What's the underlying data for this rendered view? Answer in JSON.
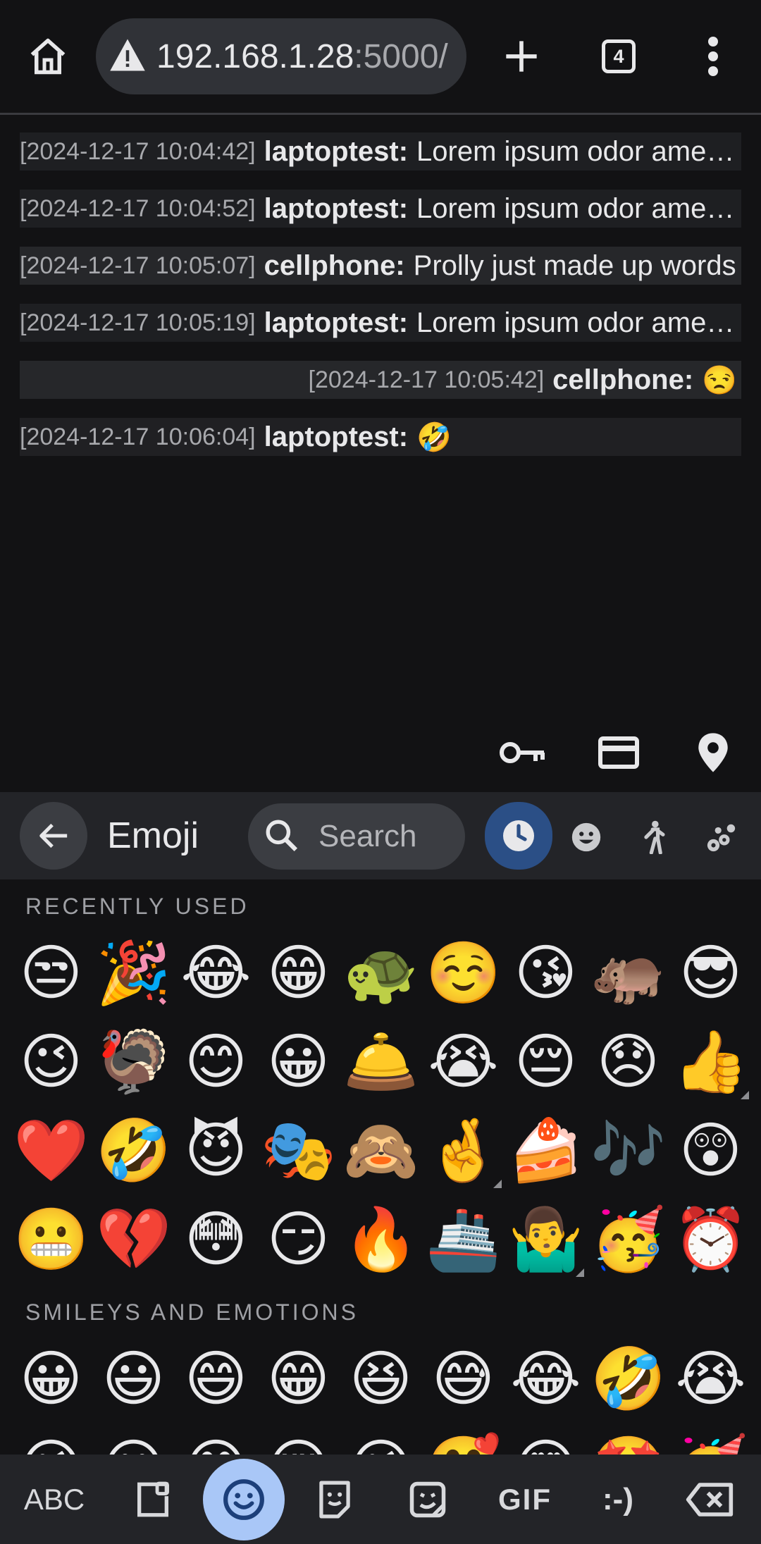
{
  "browser": {
    "url_host": "192.168.1.28",
    "url_port": ":5000/",
    "tab_count": "4"
  },
  "messages": [
    {
      "timestamp": "[2024-12-17 10:04:42]",
      "user": "laptoptest:",
      "text": "Lorem ipsum odor amet, consectetuer adipiscing elit."
    },
    {
      "timestamp": "[2024-12-17 10:04:52]",
      "user": "laptoptest:",
      "text": "Lorem ipsum odor amet, consectetuer adipiscing elit."
    },
    {
      "timestamp": "[2024-12-17 10:05:07]",
      "user": "cellphone:",
      "text": "Prolly just made up words"
    },
    {
      "timestamp": "[2024-12-17 10:05:19]",
      "user": "laptoptest:",
      "text": "Lorem ipsum odor amet, consectetuer adipiscing elit."
    },
    {
      "timestamp": "[2024-12-17 10:05:42]",
      "user": "cellphone:",
      "text": "😒"
    },
    {
      "timestamp": "[2024-12-17 10:06:04]",
      "user": "laptoptest:",
      "text": "🤣"
    }
  ],
  "autofill": {
    "icons": [
      "key-icon",
      "credit-card-icon",
      "location-pin-icon"
    ]
  },
  "keyboard": {
    "title": "Emoji",
    "search_placeholder": "Search",
    "categories": [
      "recent-clock-icon",
      "smiley-category-icon",
      "people-activity-icon",
      "animals-nature-icon"
    ],
    "active_category": "recent-clock-icon",
    "accent_color": "#2b4f86",
    "sections": {
      "recent_label": "RECENTLY USED",
      "smileys_label": "SMILEYS AND EMOTIONS"
    },
    "recent_rows": [
      [
        "😒",
        "🎉",
        "😂",
        "😁",
        "🐢",
        "☺️",
        "😘",
        "🦛",
        "😎"
      ],
      [
        "😉",
        "🦃",
        "😊",
        "😀",
        "🛎️",
        "😭",
        "😔",
        "😞",
        "👍"
      ],
      [
        "❤️",
        "🤣",
        "😈",
        "🎭",
        "🙈",
        "🤞",
        "🍰",
        "🎶",
        "😲"
      ],
      [
        "😬",
        "💔",
        "😳",
        "😏",
        "🔥",
        "🚢",
        "🤷‍♂️",
        "🥳",
        "⏰"
      ]
    ],
    "smiley_rows": [
      [
        "😀",
        "😃",
        "😄",
        "😁",
        "😆",
        "😅",
        "😂",
        "🤣",
        "😭"
      ],
      [
        "😉",
        "😗",
        "😙",
        "😚",
        "😘",
        "🥰",
        "😍",
        "🤩",
        "🥳"
      ]
    ]
  },
  "bottom_bar": {
    "abc_label": "ABC",
    "gif_label": "GIF",
    "emoticon_label": ":-)"
  }
}
